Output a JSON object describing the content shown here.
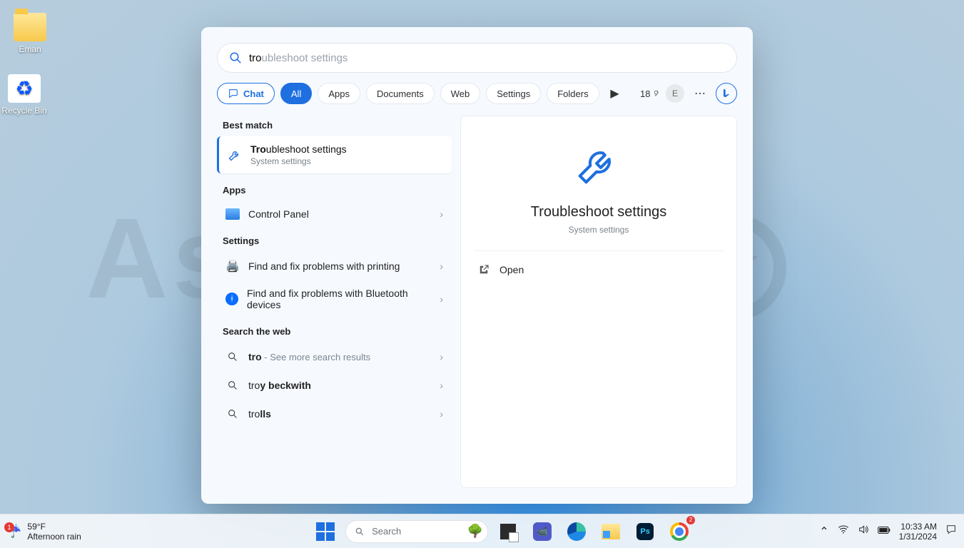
{
  "watermark_text": "AstrillVPN",
  "desktop": {
    "folder_label": "Eman",
    "recycle_label": "Recycle Bin"
  },
  "search": {
    "typed": "tro",
    "completion": "ubleshoot settings",
    "tabs": {
      "chat": "Chat",
      "all": "All",
      "apps": "Apps",
      "documents": "Documents",
      "web": "Web",
      "settings": "Settings",
      "folders": "Folders"
    },
    "rewards_points": "18",
    "avatar_initial": "E",
    "best_match_label": "Best match",
    "best_match": {
      "prefix": "Tro",
      "rest": "ubleshoot settings",
      "sub": "System settings"
    },
    "apps_label": "Apps",
    "apps": [
      {
        "label": "Control Panel"
      }
    ],
    "settings_label": "Settings",
    "settings_items": [
      {
        "label": "Find and fix problems with printing"
      },
      {
        "label": "Find and fix problems with Bluetooth devices"
      }
    ],
    "web_label": "Search the web",
    "web_items": [
      {
        "prefix": "tro",
        "rest": "",
        "suffix": " - See more search results"
      },
      {
        "prefix": "tro",
        "rest": "y beckwith",
        "suffix": ""
      },
      {
        "prefix": "tro",
        "rest": "lls",
        "suffix": ""
      }
    ],
    "preview": {
      "title": "Troubleshoot settings",
      "sub": "System settings",
      "open": "Open"
    }
  },
  "taskbar": {
    "weather": {
      "badge": "1",
      "temp": "59°F",
      "desc": "Afternoon rain"
    },
    "search_placeholder": "Search",
    "chrome_badge": "2",
    "time": "10:33 AM",
    "date": "1/31/2024"
  }
}
